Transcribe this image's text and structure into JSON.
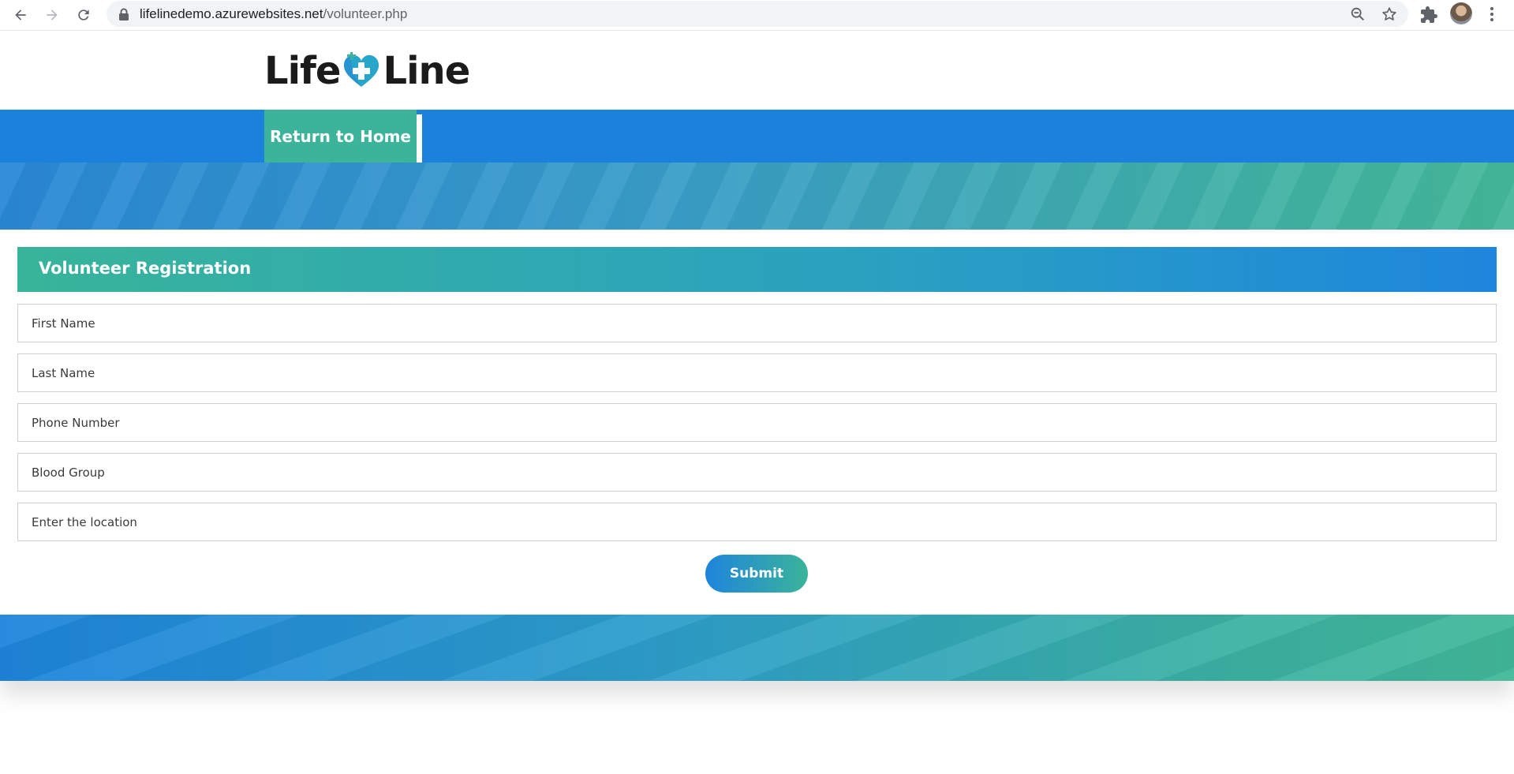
{
  "browser": {
    "url_host": "lifelinedemo.azurewebsites.net",
    "url_path": "/volunteer.php",
    "icons": [
      "back-icon",
      "forward-icon",
      "reload-icon",
      "lock-icon",
      "zoom-icon",
      "star-icon",
      "extensions-icon",
      "avatar",
      "menu-icon"
    ]
  },
  "header": {
    "logo_left": "Life",
    "logo_right": "Line",
    "home_button": "Return to Home"
  },
  "form": {
    "title": "Volunteer Registration",
    "fields": {
      "first_name": "First Name",
      "last_name": "Last Name",
      "phone": "Phone Number",
      "blood_group": "Blood Group",
      "location": "Enter the location"
    },
    "submit_label": "Submit"
  },
  "colors": {
    "brand_blue": "#1a82dc",
    "brand_green": "#3bb49a"
  }
}
